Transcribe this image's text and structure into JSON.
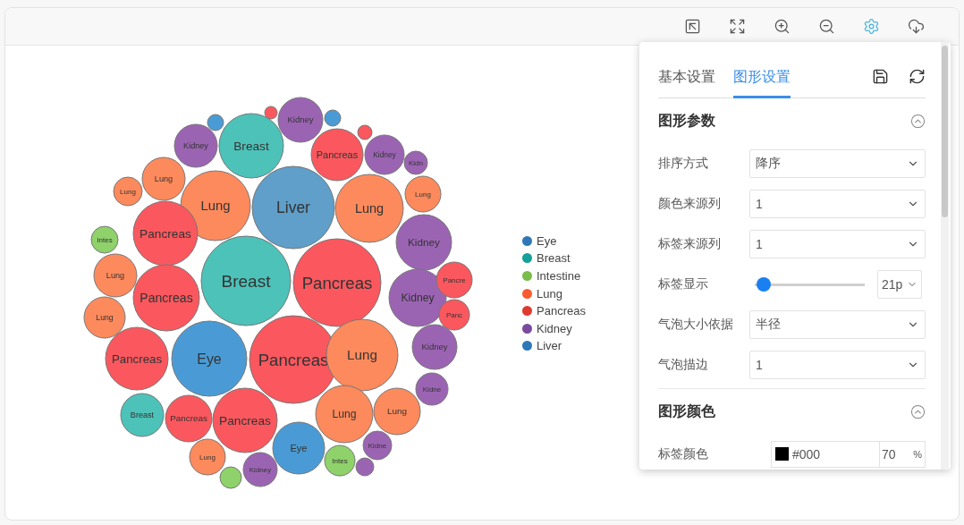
{
  "toolbar": [
    {
      "kind": "restore",
      "selected": false
    },
    {
      "kind": "fit",
      "selected": false
    },
    {
      "kind": "zoom-in",
      "selected": false
    },
    {
      "kind": "zoom-out",
      "selected": false
    },
    {
      "kind": "settings",
      "selected": true
    },
    {
      "kind": "download",
      "selected": false
    }
  ],
  "bubbles": [
    {
      "color": "#4a9bd5"
    },
    {
      "color": "#fa585e"
    },
    {
      "label": "Kidney",
      "color": "#9b64b3"
    },
    {
      "color": "#4a9bd5"
    },
    {
      "color": "#fa585e"
    },
    {
      "label": "Lung",
      "color": "#fd8a5c"
    },
    {
      "label": "Kidney",
      "color": "#9b64b3"
    },
    {
      "label": "Breast",
      "color": "#4dc2b9"
    },
    {
      "label": "Pancreas",
      "color": "#fa585e"
    },
    {
      "label": "Kidney",
      "color": "#9b64b3"
    },
    {
      "label": "Kidn",
      "color": "#9b64b3"
    },
    {
      "label": "Lung",
      "color": "#fd8a5c"
    },
    {
      "label": "Lung",
      "color": "#fd8a5c"
    },
    {
      "label": "Liver",
      "color": "#5f9fca"
    },
    {
      "label": "Lung",
      "color": "#fd8a5c"
    },
    {
      "label": "Lung",
      "color": "#fd8a5c"
    },
    {
      "label": "Intes",
      "color": "#8fd16a"
    },
    {
      "label": "Pancreas",
      "color": "#fa585e"
    },
    {
      "label": "Kidney",
      "color": "#9b64b3"
    },
    {
      "label": "Lung",
      "color": "#fd8a5c"
    },
    {
      "label": "Pancreas",
      "color": "#fa585e"
    },
    {
      "label": "Breast",
      "color": "#4dc2b9"
    },
    {
      "label": "Pancreas",
      "color": "#fa585e"
    },
    {
      "label": "Kidney",
      "color": "#9b64b3"
    },
    {
      "label": "Pancre",
      "color": "#fa585e"
    },
    {
      "label": "Lung",
      "color": "#fd8a5c"
    },
    {
      "label": "Panc",
      "color": "#fa585e"
    },
    {
      "label": "Pancreas",
      "color": "#fa585e"
    },
    {
      "label": "Eye",
      "color": "#4a9bd5"
    },
    {
      "label": "Pancreas",
      "color": "#fa585e"
    },
    {
      "label": "Lung",
      "color": "#fd8a5c"
    },
    {
      "label": "Kidney",
      "color": "#9b64b3"
    },
    {
      "label": "Breast",
      "color": "#4dc2b9"
    },
    {
      "label": "Pancreas",
      "color": "#fa585e"
    },
    {
      "label": "Pancreas",
      "color": "#fa585e"
    },
    {
      "label": "Lung",
      "color": "#fd8a5c"
    },
    {
      "label": "Lung",
      "color": "#fd8a5c"
    },
    {
      "label": "Kidne",
      "color": "#9b64b3"
    },
    {
      "label": "Lung",
      "color": "#fd8a5c"
    },
    {
      "label": "Eye",
      "color": "#4a9bd5"
    },
    {
      "label": "Intes",
      "color": "#8fd16a"
    },
    {
      "color": "#9b64b3"
    },
    {
      "label": "Kidne",
      "color": "#9b64b3"
    },
    {
      "color": "#8fd16a"
    },
    {
      "label": "Kidney",
      "color": "#9b64b3"
    }
  ],
  "legend": [
    {
      "label": "Eye",
      "color": "#2f78b8"
    },
    {
      "label": "Breast",
      "color": "#15a09a"
    },
    {
      "label": "Intestine",
      "color": "#79bd4a"
    },
    {
      "label": "Lung",
      "color": "#fb5a2e"
    },
    {
      "label": "Pancreas",
      "color": "#e03a2e"
    },
    {
      "label": "Kidney",
      "color": "#7a4a9e"
    },
    {
      "label": "Liver",
      "color": "#2f78b8"
    }
  ],
  "panel": {
    "tabs": [
      {
        "label": "基本设置",
        "selected": false
      },
      {
        "label": "图形设置",
        "selected": true
      }
    ],
    "sections": [
      {
        "title": "图形参数",
        "expanded": true,
        "rows": [
          {
            "kind": "select",
            "label": "排序方式",
            "value": "降序"
          },
          {
            "kind": "select",
            "label": "颜色来源列",
            "value": "1"
          },
          {
            "kind": "select",
            "label": "标签来源列",
            "value": "1"
          },
          {
            "kind": "slider",
            "label": "标签显示",
            "level": 0.05,
            "value": "21p"
          },
          {
            "kind": "select",
            "label": "气泡大小依据",
            "value": "半径"
          },
          {
            "kind": "select",
            "label": "气泡描边",
            "value": "1"
          }
        ]
      },
      {
        "title": "图形颜色",
        "expanded": true,
        "rows": [
          {
            "kind": "color",
            "label": "标签颜色",
            "value": "#000",
            "opacity": "70",
            "unit": "%"
          }
        ]
      }
    ]
  }
}
